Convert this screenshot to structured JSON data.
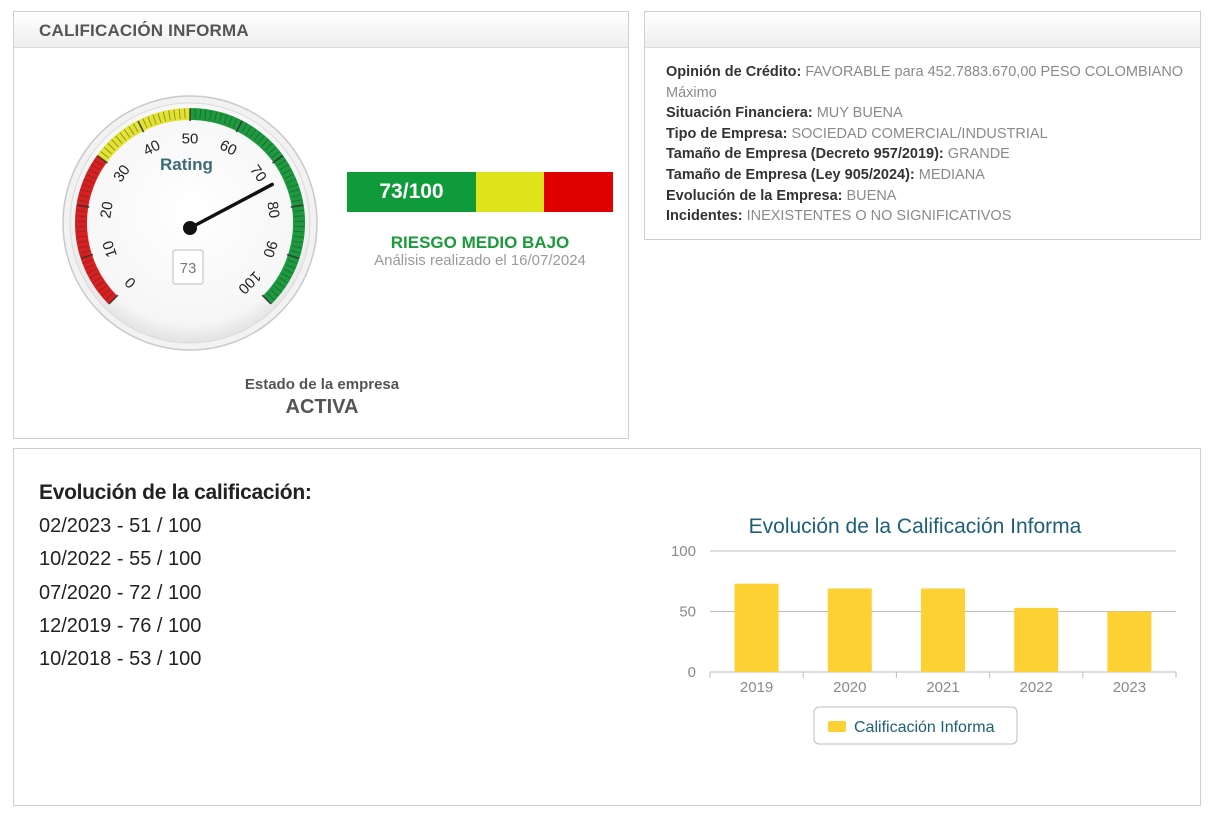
{
  "rating_panel": {
    "title": "CALIFICACIÓN INFORMA",
    "gauge": {
      "label": "Rating",
      "value": 73,
      "value_box": "73",
      "min": 0,
      "max": 100,
      "tick_labels": [
        "0",
        "10",
        "20",
        "30",
        "40",
        "50",
        "60",
        "70",
        "80",
        "90",
        "100"
      ],
      "colors": {
        "red": "#d91f1f",
        "yellow": "#e2e230",
        "green": "#1c9a3e"
      }
    },
    "score_bar": {
      "score_text": "73/100",
      "colors": {
        "green": "#0f9b3a",
        "yellow": "#dfe31a",
        "red": "#e10000"
      }
    },
    "risk_label": "RIESGO MEDIO BAJO",
    "analysis_date": "Análisis realizado el 16/07/2024",
    "estado_label": "Estado de la empresa",
    "estado_value": "ACTIVA"
  },
  "opinion_panel": {
    "rows": [
      {
        "key": "Opinión de Crédito:",
        "value": "FAVORABLE para 452.7883.670,00 PESO COLOMBIANO Máximo"
      },
      {
        "key": "Situación Financiera:",
        "value": "MUY BUENA"
      },
      {
        "key": "Tipo de Empresa:",
        "value": "SOCIEDAD COMERCIAL/INDUSTRIAL"
      },
      {
        "key": "Tamaño de Empresa (Decreto 957/2019):",
        "value": "GRANDE"
      },
      {
        "key": "Tamaño de Empresa (Ley 905/2024):",
        "value": "MEDIANA"
      },
      {
        "key": "Evolución de la Empresa:",
        "value": "BUENA"
      },
      {
        "key": "Incidentes:",
        "value": "INEXISTENTES O NO SIGNIFICATIVOS"
      }
    ]
  },
  "evolution_panel": {
    "title": "Evolución de la calificación:",
    "history": [
      "02/2023 - 51 / 100",
      "10/2022 - 55 / 100",
      "07/2020 - 72 / 100",
      "12/2019 - 76 / 100",
      "10/2018 - 53 / 100"
    ]
  },
  "chart_data": {
    "type": "bar",
    "title": "Evolución de la Calificación Informa",
    "categories": [
      "2019",
      "2020",
      "2021",
      "2022",
      "2023"
    ],
    "series": [
      {
        "name": "Calificación Informa",
        "values": [
          73,
          69,
          69,
          53,
          50
        ],
        "color": "#fdd033"
      }
    ],
    "ylim": [
      0,
      100
    ],
    "yticks": [
      0,
      50,
      100
    ],
    "grid": true,
    "legend": "bottom-center",
    "title_color": "#1d5f78"
  }
}
